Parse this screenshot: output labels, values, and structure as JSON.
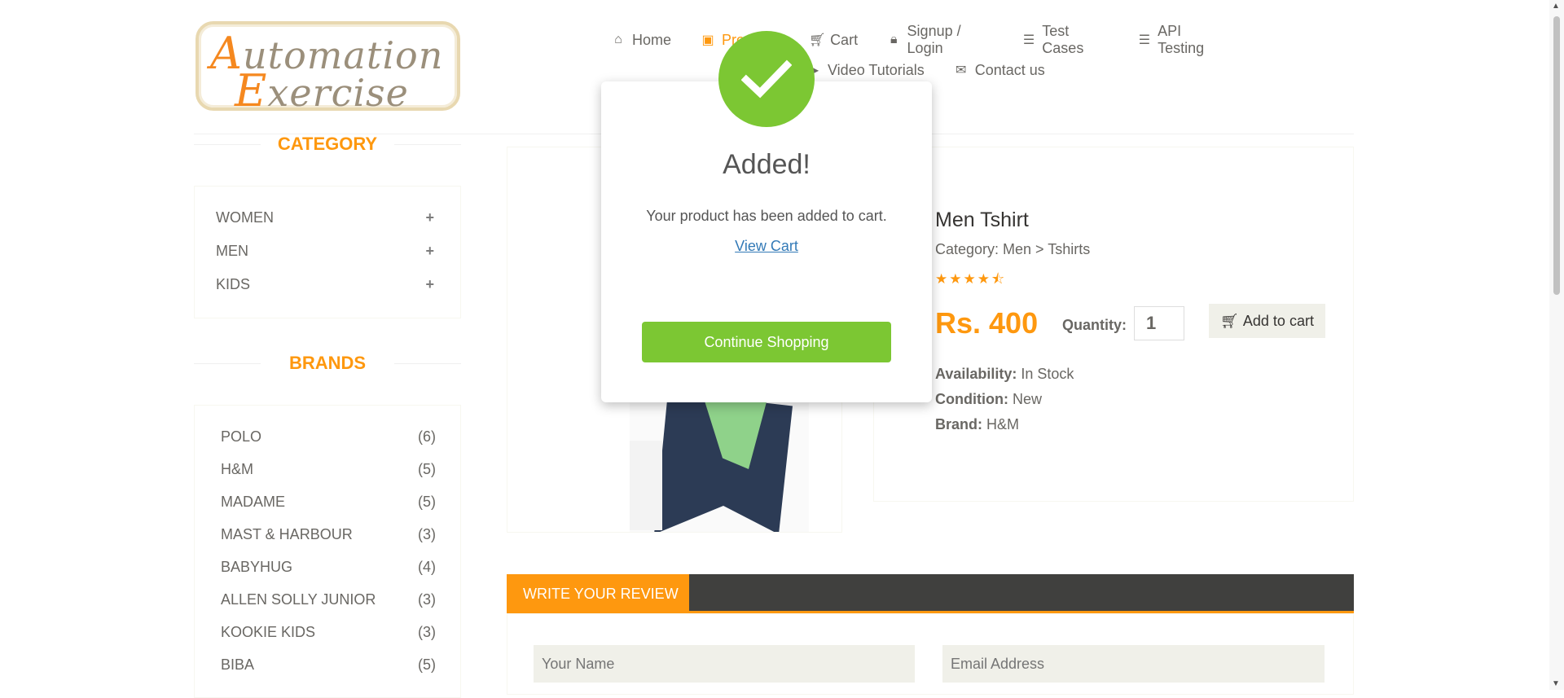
{
  "logo": {
    "line1_cap": "A",
    "line1_rest": "utomation",
    "line2_cap": "E",
    "line2_rest": "xercise"
  },
  "nav": {
    "items": [
      {
        "label": "Home",
        "icon": "home-icon"
      },
      {
        "label": "Products",
        "icon": "briefcase-icon"
      },
      {
        "label": "Cart",
        "icon": "shopping-cart-icon"
      },
      {
        "label": "Signup / Login",
        "icon": "lock-icon"
      },
      {
        "label": "Test Cases",
        "icon": "list-icon"
      },
      {
        "label": "API Testing",
        "icon": "list-icon"
      },
      {
        "label": "Video Tutorials",
        "icon": "youtube-play-icon"
      },
      {
        "label": "Contact us",
        "icon": "envelope-icon"
      }
    ]
  },
  "sidebar": {
    "category_title": "CATEGORY",
    "categories": [
      {
        "label": "WOMEN",
        "icon": "plus-icon"
      },
      {
        "label": "MEN",
        "icon": "plus-icon"
      },
      {
        "label": "KIDS",
        "icon": "plus-icon"
      }
    ],
    "brands_title": "BRANDS",
    "brands": [
      {
        "name": "POLO",
        "count": "(6)"
      },
      {
        "name": "H&M",
        "count": "(5)"
      },
      {
        "name": "MADAME",
        "count": "(5)"
      },
      {
        "name": "MAST & HARBOUR",
        "count": "(3)"
      },
      {
        "name": "BABYHUG",
        "count": "(4)"
      },
      {
        "name": "ALLEN SOLLY JUNIOR",
        "count": "(3)"
      },
      {
        "name": "KOOKIE KIDS",
        "count": "(3)"
      },
      {
        "name": "BIBA",
        "count": "(5)"
      }
    ]
  },
  "product": {
    "title": "Men Tshirt",
    "category": "Category: Men > Tshirts",
    "rating": 4.5,
    "price": "Rs. 400",
    "quantity_label": "Quantity:",
    "quantity_value": "1",
    "add_to_cart_label": "Add to cart",
    "availability_label": "Availability:",
    "availability_value": " In Stock",
    "condition_label": "Condition:",
    "condition_value": " New",
    "brand_label": "Brand:",
    "brand_value": " H&M"
  },
  "review": {
    "tab_label": "WRITE YOUR REVIEW",
    "name_placeholder": "Your Name",
    "email_placeholder": "Email Address"
  },
  "modal": {
    "title": "Added!",
    "message": "Your product has been added to cart.",
    "view_cart_label": "View Cart",
    "continue_label": "Continue Shopping"
  },
  "colors": {
    "accent": "#fe980f",
    "success": "#7cc733",
    "text": "#696763",
    "dark_bar": "#40403e"
  }
}
